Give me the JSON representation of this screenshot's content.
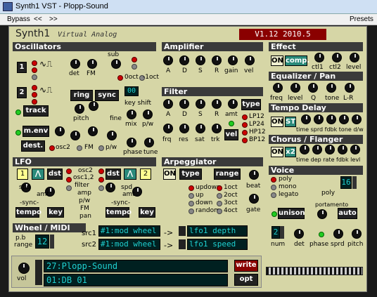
{
  "window": {
    "title": "Synth1 VST - Plopp-Sound"
  },
  "menu": {
    "bypass": "Bypass",
    "prev": "<<",
    "next": ">>",
    "presets": "Presets"
  },
  "brand": {
    "name": "Synth1",
    "sub": "Virtual Analog",
    "version": "V1.12 2010.5"
  },
  "osc": {
    "title": "Oscillators",
    "osc1": "1",
    "osc2": "2",
    "sub": "sub",
    "det": "det",
    "fm": "FM",
    "oct0": "0oct",
    "octm1": "-1oct",
    "ring": "ring",
    "sync": "sync",
    "track": "track",
    "pitch": "pitch",
    "fine": "fine",
    "key": "key",
    "shift": "shift",
    "mix": "mix",
    "pw": "p/w",
    "menv": "m.env",
    "dest": "dest.",
    "osc2lbl": "osc2",
    "fm2": "FM",
    "pw2": "p/w",
    "phase": "phase",
    "tune": "tune",
    "shiftval": "00"
  },
  "amp": {
    "title": "Amplifier",
    "a": "A",
    "d": "D",
    "s": "S",
    "r": "R",
    "gain": "gain",
    "vel": "vel"
  },
  "filter": {
    "title": "Filter",
    "a": "A",
    "d": "D",
    "s": "S",
    "r": "R",
    "amt": "amt",
    "type": "type",
    "frq": "frq",
    "res": "res",
    "sat": "sat",
    "trk": "trk",
    "vel": "vel",
    "lp12": "LP12",
    "lp24": "LP24",
    "hp12": "HP12",
    "bp12": "BP12"
  },
  "effect": {
    "title": "Effect",
    "on": "ON",
    "comp": "comp.",
    "ctl1": "ctl1",
    "ctl2": "ctl2",
    "level": "level"
  },
  "eq": {
    "title": "Equalizer / Pan",
    "freq": "freq",
    "level": "level",
    "q": "Q",
    "tone": "tone",
    "lr": "L-R"
  },
  "delay": {
    "title": "Tempo Delay",
    "on": "ON",
    "st": "ST",
    "labels": "time sprd fdbk tone d/w"
  },
  "chorus": {
    "title": "Chorus / Flanger",
    "on": "ON",
    "x2": "x2",
    "labels": "time dep rate fdbk levl"
  },
  "lfo": {
    "title": "LFO",
    "n1": "1",
    "n2": "2",
    "dst": "dst",
    "spd": "spd",
    "amt": "amt",
    "sync": "-sync-",
    "tempo": "tempo",
    "key": "key",
    "osc2": "osc2",
    "osc12": "osc1,2",
    "filter": "filter",
    "amp": "amp",
    "pw": "p/w",
    "fm": "FM",
    "pan": "pan"
  },
  "arp": {
    "title": "Arpeggiator",
    "on": "ON",
    "type": "type",
    "range": "range",
    "updown": "updown",
    "up": "up",
    "down": "down",
    "random": "random",
    "oct1": "1oct",
    "oct2": "2oct",
    "oct3": "3oct",
    "oct4": "4oct",
    "beat": "beat",
    "gate": "gate"
  },
  "voice": {
    "title": "Voice",
    "poly": "poly",
    "mono": "mono",
    "legato": "legato",
    "polylbl": "poly",
    "polyval": "16",
    "unison": "unison",
    "portamento": "portamento",
    "auto": "auto",
    "num": "num",
    "numval": "2",
    "det": "det",
    "phase": "phase",
    "sprd": "sprd",
    "pitch": "pitch"
  },
  "wheel": {
    "title": "Wheel / MIDI",
    "pb": "p.b",
    "range": "range",
    "rangeval": "12",
    "src1": "src1",
    "src2": "src2",
    "src1val": "#1:mod wheel",
    "src2val": "#1:mod wheel",
    "arrow": "->",
    "dst1": "lfo1 depth",
    "dst2": "lfo1 speed"
  },
  "patch": {
    "vol": "vol",
    "name": "27:Plopp-Sound",
    "bank": "01:DB 01",
    "write": "write",
    "opt": "opt"
  }
}
